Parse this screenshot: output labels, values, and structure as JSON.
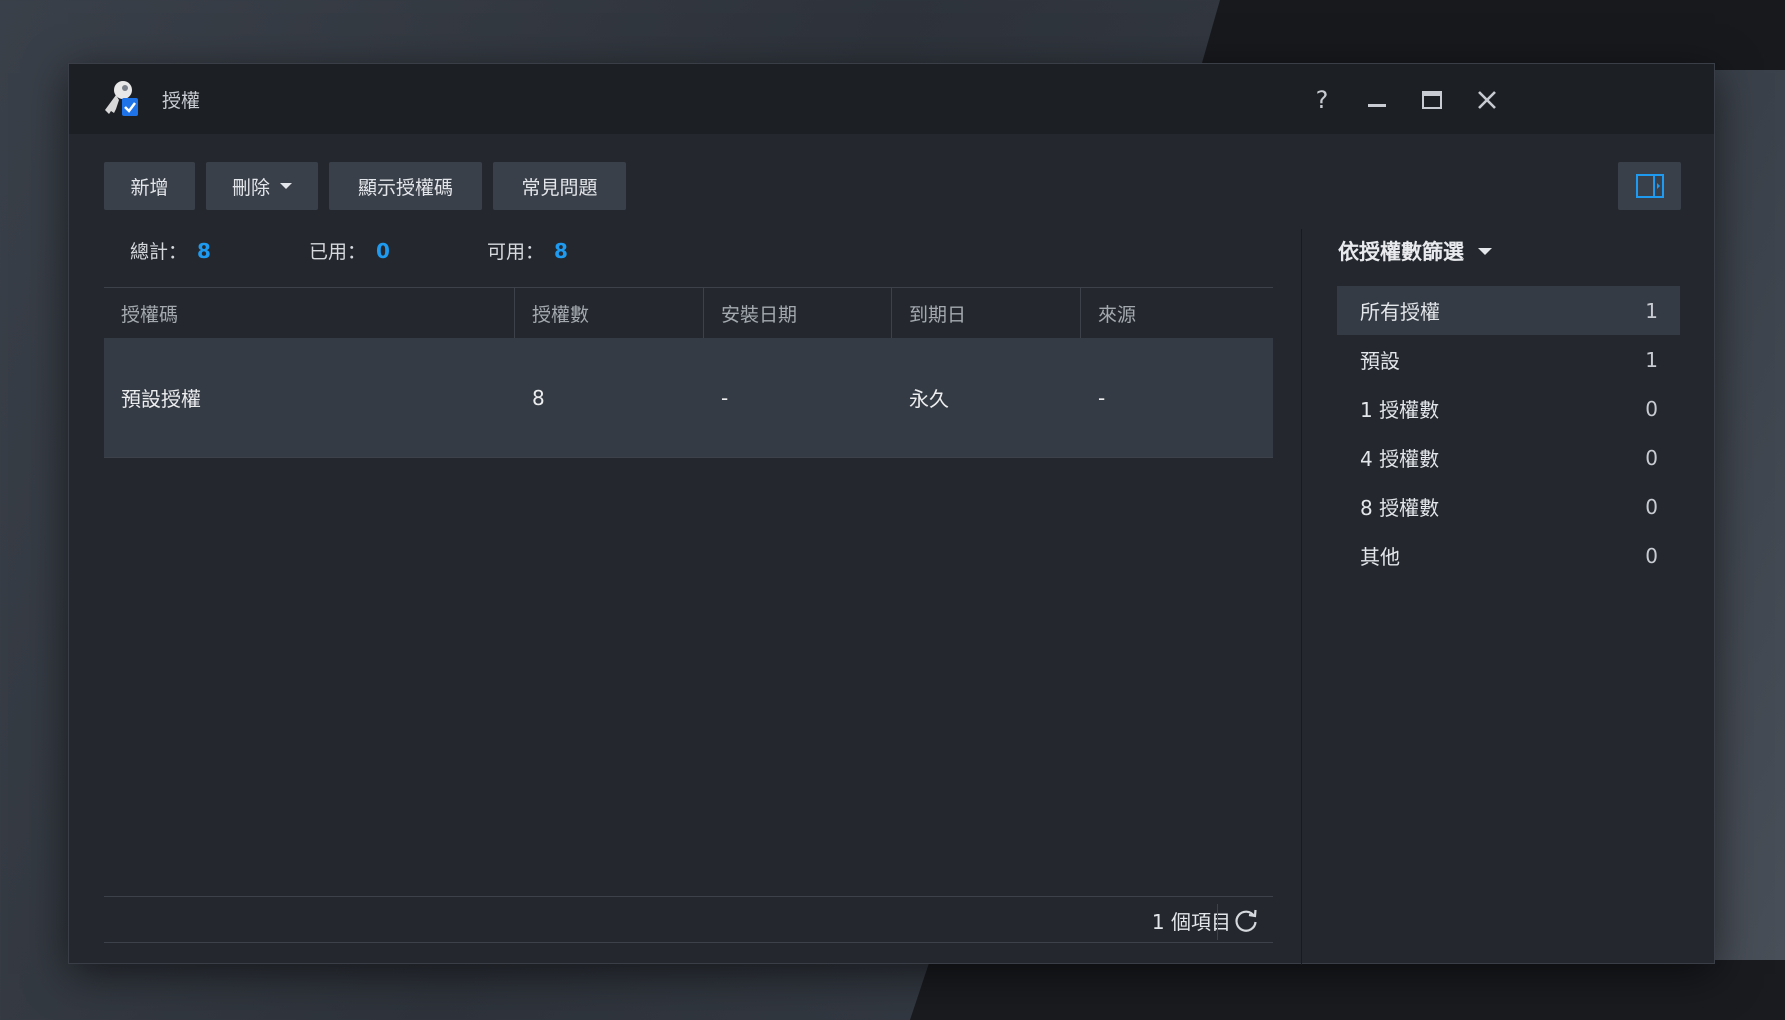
{
  "window": {
    "title": "授權"
  },
  "toolbar": {
    "add_label": "新增",
    "delete_label": "刪除",
    "show_code_label": "顯示授權碼",
    "faq_label": "常見問題"
  },
  "summary": {
    "total_label": "總計：",
    "total_value": "8",
    "used_label": "已用：",
    "used_value": "0",
    "available_label": "可用：",
    "available_value": "8"
  },
  "table": {
    "columns": [
      "授權碼",
      "授權數",
      "安裝日期",
      "到期日",
      "來源"
    ],
    "rows": [
      [
        "預設授權",
        "8",
        "-",
        "永久",
        "-"
      ]
    ]
  },
  "footer": {
    "item_count": "1 個項目"
  },
  "filter": {
    "title": "依授權數篩選",
    "items": [
      {
        "label": "所有授權",
        "count": "1"
      },
      {
        "label": "預設",
        "count": "1"
      },
      {
        "label": "1 授權數",
        "count": "0"
      },
      {
        "label": "4 授權數",
        "count": "0"
      },
      {
        "label": "8 授權數",
        "count": "0"
      },
      {
        "label": "其他",
        "count": "0"
      }
    ]
  },
  "colors": {
    "accent": "#1e9bf0",
    "window_bg": "#24282e",
    "titlebar_bg": "#1c1f24",
    "selected_row": "#353b44"
  }
}
